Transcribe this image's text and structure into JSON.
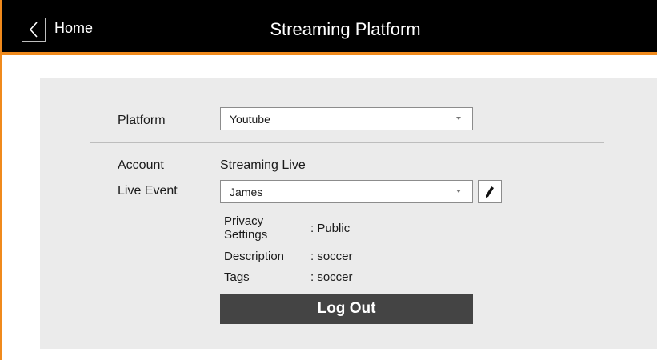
{
  "header": {
    "back_label": "Home",
    "title": "Streaming Platform",
    "back_icon": "chevron-left-icon",
    "accent_color": "#f08a1c",
    "bar_color": "#000000"
  },
  "form": {
    "platform_label": "Platform",
    "platform_value": "Youtube",
    "account_label": "Account",
    "account_value": "Streaming Live",
    "live_event_label": "Live Event",
    "live_event_value": "James",
    "edit_icon": "pencil-icon",
    "details": [
      {
        "label": "Privacy\nSettings",
        "value": ": Public"
      },
      {
        "label": "Description",
        "value": ": soccer"
      },
      {
        "label": "Tags",
        "value": ": soccer"
      }
    ],
    "logout_label": "Log Out"
  }
}
